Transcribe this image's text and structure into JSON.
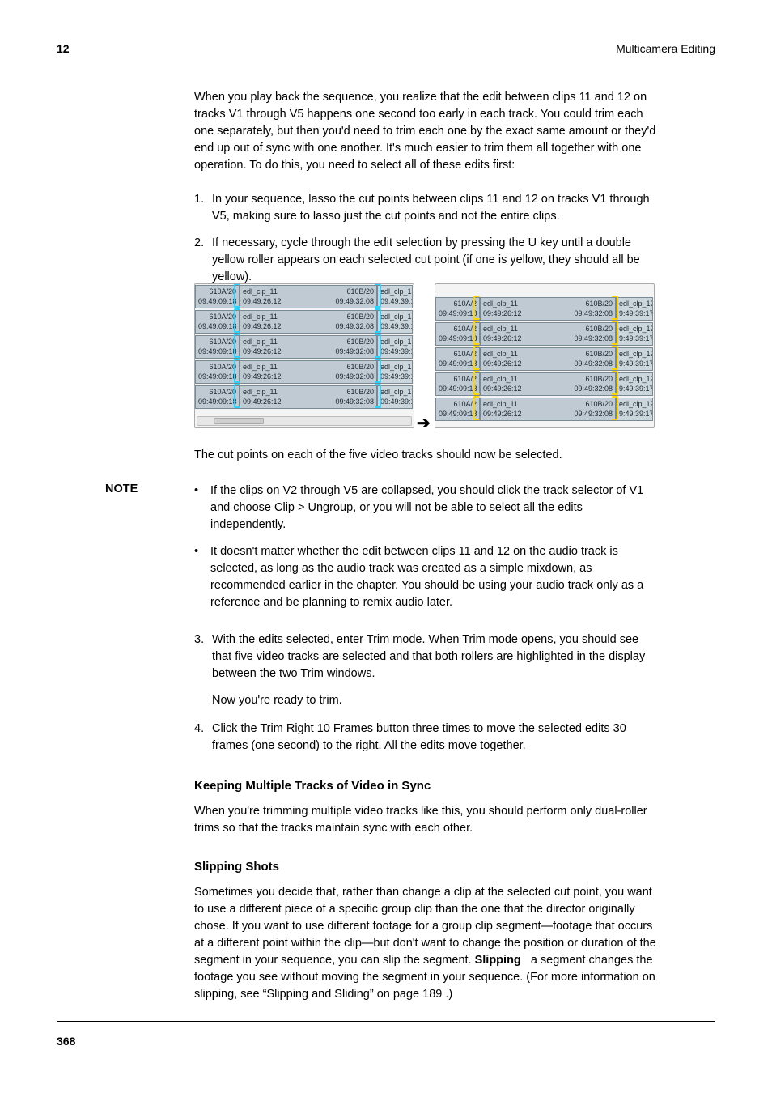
{
  "header": {
    "folio": "12",
    "chapter": "Multicamera Editing"
  },
  "intro_para": "When you play back the sequence, you realize that the edit between clips 11 and 12 on tracks V1 through V5 happens one second too early in each track. You could trim each one separately, but then you'd need to trim each one by the exact same amount or they'd end up out of sync with one another. It's much easier to trim them all together with one operation. To do this, you need to select all of these edits first:",
  "steps_a": [
    {
      "num": "1.",
      "text": "In your sequence, lasso the cut points between clips 11 and 12 on tracks V1 through V5, making sure to lasso just the cut points and not the entire clips."
    },
    {
      "num": "2.",
      "text": "If necessary, cycle through the edit selection by pressing the U key until a double yellow roller appears on each selected cut point (if one is yellow, they should all be yellow)."
    }
  ],
  "fig": {
    "clip_left": {
      "name": "edl_clp_11",
      "rt": "610A/20",
      "lb": "09:49:09:18",
      "rb": "09:49:26:12"
    },
    "clip_mid": {
      "rt": "610B/20",
      "lb": "09:49:32:08"
    },
    "clip_right": {
      "name": "edl_clp_12",
      "lb": "09:49:39:17"
    },
    "right_pane_lb": "9:49:39:17",
    "right_pane_610a": "610A/2"
  },
  "after_fig_para": "The cut points on each of the five video tracks should now be selected.",
  "notes": [
    "If the clips on V2 through V5 are collapsed, you should click the track selector of V1 and choose Clip > Ungroup, or you will not be able to select all the edits independently.",
    "It doesn't matter whether the edit between clips 11 and 12 on the audio track is selected, as long as the audio track was created as a simple mixdown, as recommended earlier in the chapter. You should be using your audio track only as a reference and be planning to remix audio later."
  ],
  "steps_b": [
    {
      "num": "3.",
      "text": "With the edits selected, enter Trim mode. When Trim mode opens, you should see that five video tracks are selected and that both rollers are highlighted in the display between the two Trim windows.",
      "trailer": "Now you're ready to trim."
    },
    {
      "num": "4.",
      "text": "Click the Trim Right 10 Frames button three times to move the selected edits 30 frames (one second) to the right. All the edits move together."
    }
  ],
  "note_label": "NOTE",
  "keeping_head": "Keeping Multiple Tracks of Video in Sync",
  "keeping_para": "When you're trimming multiple video tracks like this, you should perform only dual-roller trims so that the tracks maintain sync with each other.",
  "slipping_head": "Slipping Shots",
  "slipping_runin": "Slipping",
  "slipping_para": "Sometimes you decide that, rather than change a clip at the selected cut point, you want to use a different piece of a specific group clip than the one that the director originally chose. If you want to use different footage for a group clip segment—footage that occurs at a different point within the clip—but don't want to change the position or duration of the segment in your sequence, you can slip the segment. ",
  "slipping_para_tail_a": " a segment changes the footage you see without moving the segment in your sequence. (For more information on slipping, see ",
  "slipping_xref": "“Slipping and Sliding” on page 189",
  "slipping_para_tail_b": ".)",
  "page_number": "368"
}
